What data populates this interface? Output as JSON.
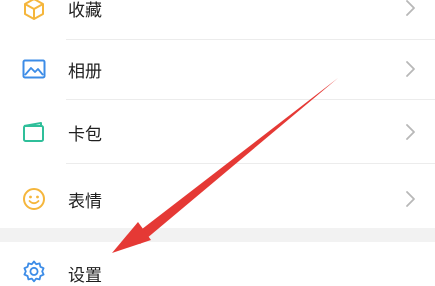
{
  "menu": {
    "items": [
      {
        "label": "收藏",
        "icon": "favorites-cube-icon",
        "icon_color": "#F5B63C"
      },
      {
        "label": "相册",
        "icon": "album-picture-icon",
        "icon_color": "#3C8CE7"
      },
      {
        "label": "卡包",
        "icon": "card-wallet-icon",
        "icon_color": "#2FBF9A"
      },
      {
        "label": "表情",
        "icon": "emoji-smile-icon",
        "icon_color": "#F5B63C"
      },
      {
        "label": "设置",
        "icon": "settings-gear-icon",
        "icon_color": "#3C8CE7"
      }
    ]
  },
  "annotation": {
    "arrow_color": "#E53935",
    "points_to": "设置"
  },
  "colors": {
    "background": "#FFFFFF",
    "section_gap": "#F2F2F2",
    "chevron": "#B8B8B8",
    "text": "#1F1F1F"
  }
}
